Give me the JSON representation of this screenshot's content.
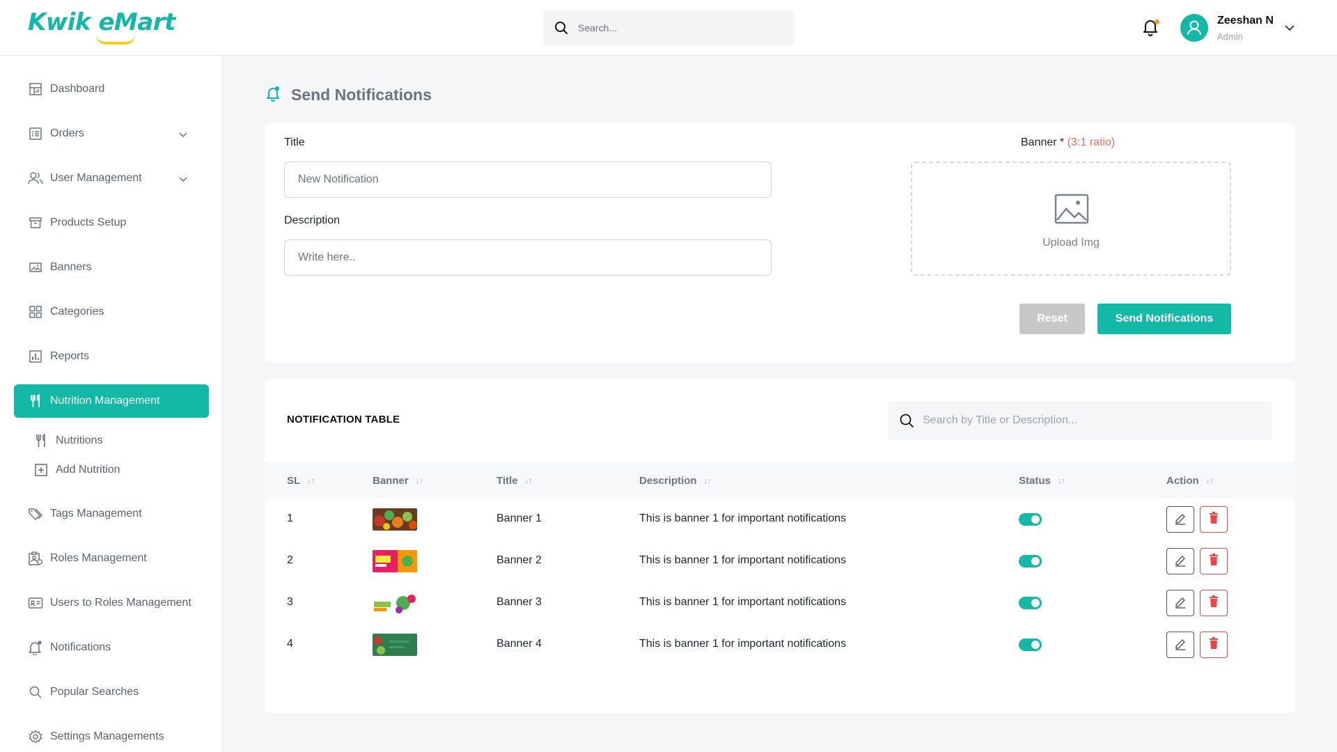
{
  "app": {
    "logo_text": "Kwik eMart"
  },
  "header": {
    "search_placeholder": "Search...",
    "user_name": "Zeeshan N",
    "user_role": "Admin"
  },
  "sidebar": {
    "items": [
      {
        "label": "Dashboard",
        "icon": "dashboard-icon"
      },
      {
        "label": "Orders",
        "icon": "orders-icon",
        "expandable": true
      },
      {
        "label": "User Management",
        "icon": "users-icon",
        "expandable": true
      },
      {
        "label": "Products Setup",
        "icon": "archive-box-icon"
      },
      {
        "label": "Banners",
        "icon": "image-icon"
      },
      {
        "label": "Categories",
        "icon": "grid-icon"
      },
      {
        "label": "Reports",
        "icon": "bar-chart-icon"
      },
      {
        "label": "Nutrition Management",
        "icon": "fork-knife-icon",
        "active": true
      },
      {
        "label": "Tags Management",
        "icon": "tags-icon"
      },
      {
        "label": "Roles Management",
        "icon": "roles-icon"
      },
      {
        "label": "Users to Roles Management",
        "icon": "id-card-icon"
      },
      {
        "label": "Notifications",
        "icon": "bell-icon"
      },
      {
        "label": "Popular Searches",
        "icon": "search-icon"
      },
      {
        "label": "Settings Managements",
        "icon": "gear-icon"
      }
    ],
    "sub_items": [
      {
        "label": "Nutritions",
        "icon": "fork-knife-icon"
      },
      {
        "label": "Add Nutrition",
        "icon": "plus-square-icon"
      }
    ]
  },
  "page": {
    "title": "Send Notifications"
  },
  "form": {
    "title_label": "Title",
    "title_placeholder": "New Notification",
    "description_label": "Description",
    "description_placeholder": "Write here..",
    "banner_label": "Banner *",
    "banner_ratio": "(3:1 ratio)",
    "upload_text": "Upload Img",
    "reset_label": "Reset",
    "send_label": "Send Notifications"
  },
  "table": {
    "title": "NOTIFICATION TABLE",
    "search_placeholder": "Search by Title or Description...",
    "columns": [
      "SL",
      "Banner",
      "Title",
      "Description",
      "Status",
      "Action"
    ],
    "rows": [
      {
        "sl": "1",
        "banner": "banner-thumb-vegetables",
        "title": "Banner 1",
        "description": "This is banner 1 for important notifications",
        "status": true
      },
      {
        "sl": "2",
        "banner": "banner-thumb-stay-sale",
        "title": "Banner 2",
        "description": "This is banner 1 for important notifications",
        "status": true
      },
      {
        "sl": "3",
        "banner": "banner-thumb-super-savings",
        "title": "Banner 3",
        "description": "This is banner 1 for important notifications",
        "status": true
      },
      {
        "sl": "4",
        "banner": "banner-thumb-green-produce",
        "title": "Banner 4",
        "description": "This is banner 1 for important notifications",
        "status": true
      }
    ]
  },
  "colors": {
    "accent": "#14b8a6",
    "danger": "#ef4444",
    "ratio_text": "#f26b5b",
    "logo_smile": "#facc15"
  }
}
